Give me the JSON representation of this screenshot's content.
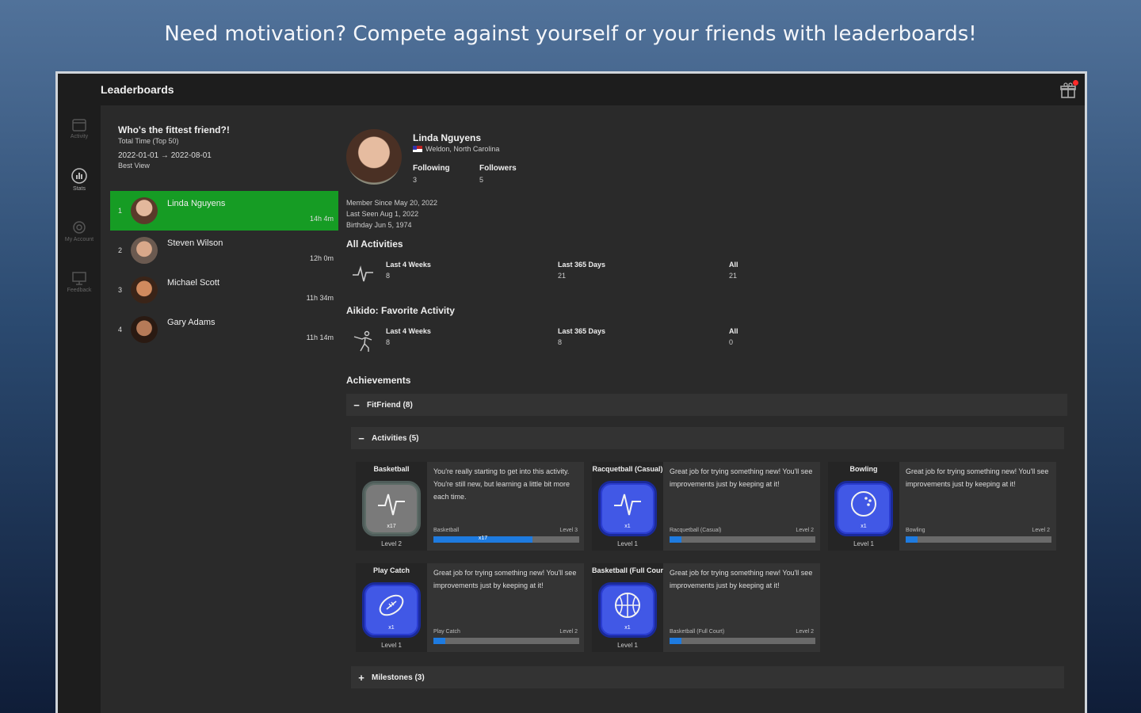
{
  "caption": "Need motivation? Compete against yourself or your friends with leaderboards!",
  "app": {
    "title": "Leaderboards"
  },
  "rail": [
    {
      "label": "Activity",
      "icon": "calendar-icon"
    },
    {
      "label": "Stats",
      "icon": "leaderboard-icon"
    },
    {
      "label": "My Account",
      "icon": "gear-icon"
    },
    {
      "label": "Feedback",
      "icon": "feedback-icon"
    }
  ],
  "leaderboard": {
    "title": "Who's the fittest friend?!",
    "subtitle": "Total Time (Top 50)",
    "dates": "2022-01-01 → 2022-08-01",
    "view": "Best View",
    "entries": [
      {
        "rank": "1",
        "name": "Linda Nguyens",
        "time": "14h 4m"
      },
      {
        "rank": "2",
        "name": "Steven Wilson",
        "time": "12h 0m"
      },
      {
        "rank": "3",
        "name": "Michael Scott",
        "time": "11h 34m"
      },
      {
        "rank": "4",
        "name": "Gary Adams",
        "time": "11h 14m"
      }
    ]
  },
  "profile": {
    "name": "Linda Nguyens",
    "location": "Weldon, North Carolina",
    "following_label": "Following",
    "following": "3",
    "followers_label": "Followers",
    "followers": "5",
    "member_since": "Member Since May 20, 2022",
    "last_seen": "Last Seen Aug 1, 2022",
    "birthday": "Birthday Jun 5, 1974"
  },
  "all_activities": {
    "title": "All Activities",
    "stats": [
      {
        "label": "Last 4 Weeks",
        "value": "8"
      },
      {
        "label": "Last 365 Days",
        "value": "21"
      },
      {
        "label": "All",
        "value": "21"
      }
    ]
  },
  "favorite": {
    "title": "Aikido: Favorite Activity",
    "stats": [
      {
        "label": "Last 4 Weeks",
        "value": "8"
      },
      {
        "label": "Last 365 Days",
        "value": "8"
      },
      {
        "label": "All",
        "value": "0"
      }
    ]
  },
  "achievements": {
    "title": "Achievements",
    "fitfriend": "FitFriend (8)",
    "activities": "Activities (5)",
    "milestones": "Milestones (3)",
    "cards": [
      {
        "name": "Basketball",
        "desc": "You're really starting to get into this activity. You're still new, but learning a little bit more each time.",
        "count": "x17",
        "level": "Level 2",
        "bar_left": "Basketball",
        "bar_right": "Level 3",
        "progress": 0.68,
        "fill_label": "x17",
        "style": "gray",
        "icon": "pulse-icon"
      },
      {
        "name": "Racquetball (Casual)",
        "desc": "Great job for trying something new! You'll see improvements just by keeping at it!",
        "count": "x1",
        "level": "Level 1",
        "bar_left": "Racquetball (Casual)",
        "bar_right": "Level 2",
        "progress": 0.08,
        "fill_label": "",
        "style": "blue",
        "icon": "pulse-icon"
      },
      {
        "name": "Bowling",
        "desc": "Great job for trying something new! You'll see improvements just by keeping at it!",
        "count": "x1",
        "level": "Level 1",
        "bar_left": "Bowling",
        "bar_right": "Level 2",
        "progress": 0.08,
        "fill_label": "",
        "style": "blue",
        "icon": "bowling-ball-icon"
      },
      {
        "name": "Play Catch",
        "desc": "Great job for trying something new! You'll see improvements just by keeping at it!",
        "count": "x1",
        "level": "Level 1",
        "bar_left": "Play Catch",
        "bar_right": "Level 2",
        "progress": 0.08,
        "fill_label": "",
        "style": "blue",
        "icon": "football-icon"
      },
      {
        "name": "Basketball (Full Court)",
        "desc": "Great job for trying something new! You'll see improvements just by keeping at it!",
        "count": "x1",
        "level": "Level 1",
        "bar_left": "Basketball (Full Court)",
        "bar_right": "Level 2",
        "progress": 0.08,
        "fill_label": "",
        "style": "blue",
        "icon": "basketball-icon"
      }
    ]
  },
  "colors": {
    "selected_row": "#169c24",
    "badge_blue": "#4158e6",
    "progress": "#1e7be0"
  }
}
